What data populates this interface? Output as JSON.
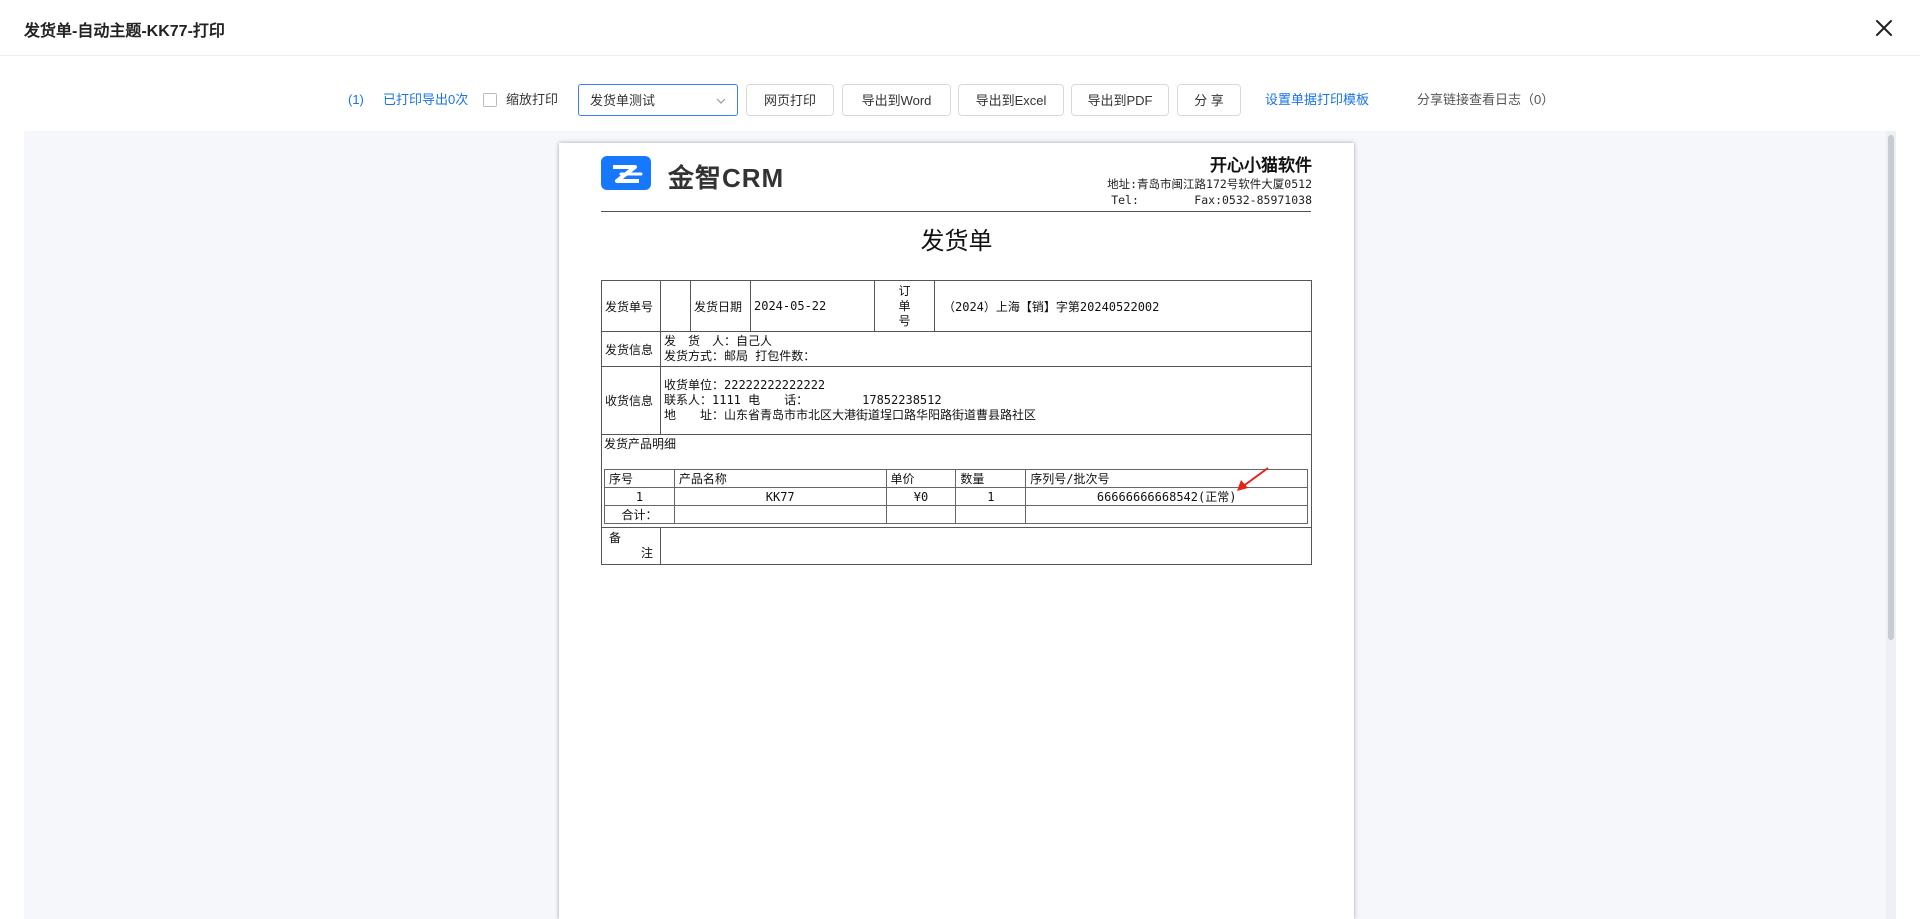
{
  "window": {
    "title": "发货单-自动主题-KK77-打印"
  },
  "toolbar": {
    "count_link": "(1)",
    "printed_text": "已打印导出0次",
    "scale_print_label": "缩放打印",
    "scale_print_checked": false,
    "template_select_value": "发货单测试",
    "btn_web_print": "网页打印",
    "btn_export_word": "导出到Word",
    "btn_export_excel": "导出到Excel",
    "btn_export_pdf": "导出到PDF",
    "btn_share": "分 享",
    "set_template_link": "设置单据打印模板",
    "share_log_text": "分享链接查看日志（0）"
  },
  "doc": {
    "logo_text": "金智CRM",
    "company_name": "开心小猫软件",
    "address_line": "地址:青岛市闽江路172号软件大厦0512",
    "tel_label": "Tel:",
    "fax_line": "Fax:0532-85971038",
    "title": "发货单",
    "fields": {
      "ship_no_label": "发货单号",
      "ship_no_value": "",
      "ship_date_label": "发货日期",
      "ship_date_value": "2024-05-22",
      "order_no_label_1": "订",
      "order_no_label_2": "单",
      "order_no_label_3": "号",
      "order_no_value": "（2024）上海【销】字第20240522002",
      "ship_info_label": "发货信息",
      "shipper_line": "发　货　人：自己人",
      "ship_method_line": "发货方式：邮局 打包件数：",
      "recv_info_label": "收货信息",
      "recv_unit_line": "收货单位：22222222222222",
      "contact_line": "联系人：1111 电　　话：　　　　　17852238512",
      "address_recv_line": "地　　址：山东省青岛市市北区大港街道埕口路华阳路街道曹县路社区",
      "detail_label": "发货产品明细",
      "remark_label_1": "备",
      "remark_label_2": "注"
    },
    "items_table": {
      "headers": [
        "序号",
        "产品名称",
        "单价",
        "数量",
        "序列号/批次号"
      ],
      "rows": [
        [
          "1",
          "KK77",
          "¥0",
          "1",
          "66666666668542(正常)"
        ]
      ],
      "total_label": "合计："
    }
  },
  "colors": {
    "link": "#1a73e8",
    "select_border": "#3c7cf0",
    "logo_blue": "#1677ff",
    "arrow_red": "#e8201a"
  }
}
